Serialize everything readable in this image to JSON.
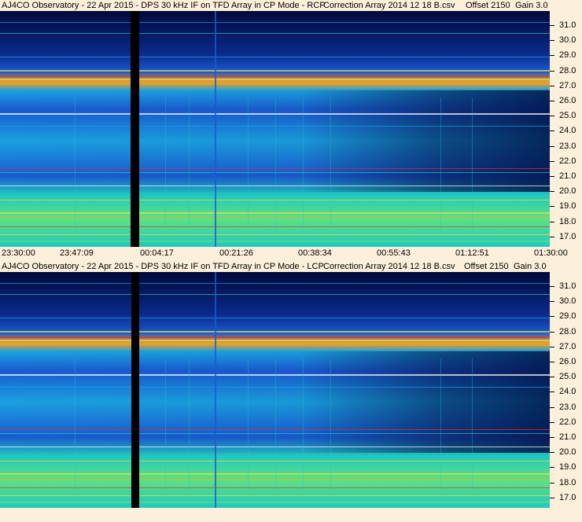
{
  "panels": [
    {
      "title_main": "AJ4CO Observatory - 22 Apr 2015 - DPS 30 kHz IF on TFD Array in CP Mode - RCP",
      "title_correction": "Correction Array 2014 12 18 B.csv",
      "title_offset": "Offset 2150",
      "title_gain": "Gain 3.0",
      "y_labels": [
        "31.0",
        "30.0",
        "29.0",
        "28.0",
        "27.0",
        "26.0",
        "25.0",
        "24.0",
        "23.0",
        "22.0",
        "21.0",
        "20.0",
        "19.0",
        "18.0",
        "17.0"
      ]
    },
    {
      "title_main": "AJ4CO Observatory - 22 Apr 2015 - DPS 30 kHz IF on TFD Array in CP Mode - LCP",
      "title_correction": "Correction Array 2014 12 18 B.csv",
      "title_offset": "Offset 2150",
      "title_gain": "Gain 3.0",
      "y_labels": [
        "31.0",
        "30.0",
        "29.0",
        "28.0",
        "27.0",
        "26.0",
        "25.0",
        "24.0",
        "23.0",
        "22.0",
        "21.0",
        "20.0",
        "19.0",
        "18.0",
        "17.0"
      ]
    }
  ],
  "x_labels": [
    "23:30:00",
    "23:47:09",
    "00:04:17",
    "00:21:26",
    "00:38:34",
    "00:55:43",
    "01:12:51",
    "01:30:00"
  ],
  "colors": {
    "background": "#fdf0da",
    "deep": "#000a3a",
    "dark_blue": "#0a2a8a",
    "blue": "#1a5ad0",
    "cyan": "#1aa0e0",
    "teal": "#20c8c0",
    "green": "#60e080",
    "yellow": "#e8e040",
    "orange": "#f0a020",
    "red": "#e03030",
    "data_gap": "#000000"
  }
}
